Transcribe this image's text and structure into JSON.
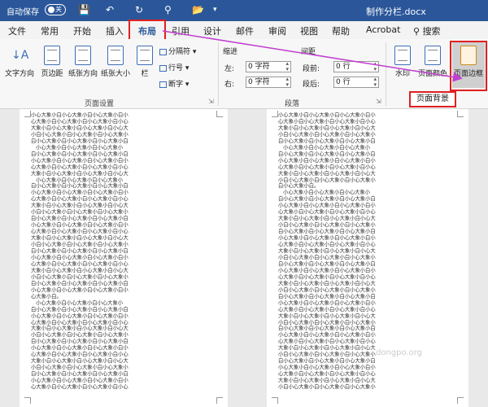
{
  "titlebar": {
    "autosave_label": "自动保存",
    "toggle_label": "关",
    "filename": "制作分栏.docx"
  },
  "tabs": [
    {
      "label": "文件"
    },
    {
      "label": "常用"
    },
    {
      "label": "开始"
    },
    {
      "label": "插入"
    },
    {
      "label": "布局",
      "active": true
    },
    {
      "label": "引用"
    },
    {
      "label": "设计"
    },
    {
      "label": "邮件"
    },
    {
      "label": "审阅"
    },
    {
      "label": "视图"
    },
    {
      "label": "帮助"
    },
    {
      "label": "Acrobat"
    },
    {
      "label": "搜索"
    }
  ],
  "ribbon": {
    "page_setup": {
      "buttons": [
        "文字方向",
        "页边距",
        "纸张方向",
        "纸张大小",
        "栏"
      ],
      "small": [
        "分隔符",
        "行号",
        "断字"
      ],
      "label": "页面设置"
    },
    "paragraph": {
      "indent_label": "缩进",
      "spacing_label": "间距",
      "left_label": "左:",
      "right_label": "右:",
      "before_label": "段前:",
      "after_label": "段后:",
      "left_value": "0 字符",
      "right_value": "0 字符",
      "before_value": "0 行",
      "after_value": "0 行",
      "label": "段落"
    },
    "page_background": {
      "buttons": [
        "水印",
        "页面颜色",
        "页面边框"
      ],
      "label": "页面背景"
    }
  },
  "callout_label": "页面背景",
  "watermark": "dongpo.org",
  "doc_left": [
    "小心大象小白小心大象小白小心大象小白小",
    "心大象小白小心大象小白小心大象小白小心",
    "大象小白小心大象小白小心大象小白小心大",
    "小白小心大象小白小心大象小白小心大象小",
    "白小心大象小白小心大象小白小心大象小白",
    "   小心大象小白小心大象小白小心大象小",
    "白小心大象小白小心大象小白小心大象小白",
    "小心大象小白小心大象小白小心大象小白小",
    "心大象小白小心大象小白小心大象小白小心",
    "大象小白小心大象小白小心大象小白小心大",
    "   小心大象小白小心大象小白小心大象小",
    "白小心大象小白小心大象小白小心大象小白",
    "小心大象小白小心大象小白小心大象小白小",
    "心大象小白小心大象小白小心大象小白小心",
    "大象小白小心大象小白小心大象小白小心大",
    "小白小心大象小白小心大象小白小心大象小",
    "白小心大象小白小心大象小白小心大象小白",
    "小心大象小白小心大象小白小心大象小白小",
    "心大象小白小心大象小白小心大象小白小心",
    "大象小白小心大象小白小心大象小白小心大",
    "小白小心大象小白小心大象小白小心大象小",
    "白小心大象小白小心大象小白小心大象小白",
    "小心大象小白小心大象小白小心大象小白小",
    "心大象小白小心大象小白小心大象小白小心",
    "大象小白小心大象小白小心大象小白小心大",
    "小白小心大象小白小心大象小白小心大象小",
    "白小心大象小白小心大象小白小心大象小白",
    "小心大象小白小心大象小白小心大象小白小",
    "心大象小白。",
    "   小心大象小白小心大象小白小心大象小",
    "白小心大象小白小心大象小白小心大象小白",
    "小心大象小白小心大象小白小心大象小白小",
    "心大象小白小心大象小白小心大象小白小心",
    "大象小白小心大象小白小心大象小白小心大",
    "小白小心大象小白小心大象小白小心大象小",
    "白小心大象小白小心大象小白小心大象小白",
    "小心大象小白小心大象小白小心大象小白小",
    "心大象小白小心大象小白小心大象小白小心",
    "大象小白小心大象小白小心大象小白小心大",
    "小白小心大象小白小心大象小白小心大象小",
    "白小心大象小白小心大象小白小心大象小白",
    "小心大象小白小心大象小白小心大象小白小",
    "心大象小白小心大象小白小心大象小白小心"
  ],
  "doc_right": [
    "小心大象小白小心大象小白小心大象小白小",
    "心大象小白小心大象小白小心大象小白小心",
    "大象小白小心大象小白小心大象小白小心大",
    "小白小心大象小白小心大象小白小心大象小",
    "白小心大象小白小心大象小白小心大象小白",
    "   小心大象小白小心大象小白小心大象小",
    "白小心大象小白小心大象小白小心大象小白",
    "小心大象小白小心大象小白小心大象小白小",
    "心大象小白小心大象小白小心大象小白小心",
    "大象小白小心大象小白小心大象小白小心大",
    "小白小心大象小白小心大象小白小心大象小",
    "白小心大象小白。",
    "   小心大象小白小心大象小白小心大象小",
    "白小心大象小白小心大象小白小心大象小白",
    "小心大象小白小心大象小白小心大象小白小",
    "心大象小白小心大象小白小心大象小白小心",
    "大象小白小心大象小白小心大象小白小心大",
    "小白小心大象小白小心大象小白小心大象小",
    "白小心大象小白小心大象小白小心大象小白",
    "小心大象小白小心大象小白小心大象小白小",
    "心大象小白小心大象小白小心大象小白小心",
    "大象小白小心大象小白小心大象小白小心大",
    "小白小心大象小白小心大象小白小心大象小",
    "白小心大象小白小心大象小白小心大象小白",
    "小心大象小白小心大象小白小心大象小白小",
    "心大象小白小心大象小白小心大象小白小心",
    "大象小白小心大象小白小心大象小白小心大",
    "小白小心大象小白小心大象小白小心大象小",
    "白小心大象小白小心大象小白小心大象小白",
    "小心大象小白小心大象小白小心大象小白小",
    "心大象小白小心大象小白小心大象小白小心",
    "大象小白小心大象小白小心大象小白小心大",
    "小白小心大象小白小心大象小白小心大象小",
    "白小心大象小白小心大象小白小心大象小白",
    "小心大象小白小心大象小白小心大象小白小",
    "心大象小白小心大象小白小心大象小白小心",
    "大象小白小心大象小白小心大象小白小心大",
    "小白小心大象小白小心大象小白小心大象小",
    "白小心大象小白小心大象小白小心大象小白",
    "小心大象小白小心大象小白小心大象小白小",
    "心大象小白小心大象小白小心大象小白小心",
    "大象小白小心大象小白小心大象小白小心大",
    "小白小心大象小白小心大象小白小心大象小"
  ]
}
